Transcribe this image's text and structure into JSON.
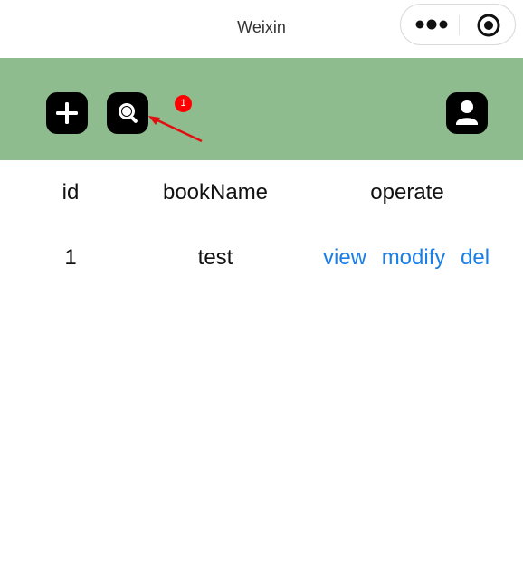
{
  "titlebar": {
    "title": "Weixin",
    "menu_icon": "more-dots-icon",
    "close_icon": "target-circle-icon"
  },
  "toolbar": {
    "add_icon": "plus-icon",
    "search_icon": "search-icon",
    "user_icon": "user-icon",
    "badge_text": "1",
    "background": "#8fbc8f",
    "button_color": "#000000"
  },
  "table": {
    "headers": [
      "id",
      "bookName",
      "operate"
    ],
    "rows": [
      {
        "id": "1",
        "bookName": "test",
        "actions": [
          "view",
          "modify",
          "del"
        ]
      }
    ]
  },
  "colors": {
    "link": "#1a7fe6",
    "badge": "#ff0000",
    "annotation_arrow": "#e01010"
  }
}
